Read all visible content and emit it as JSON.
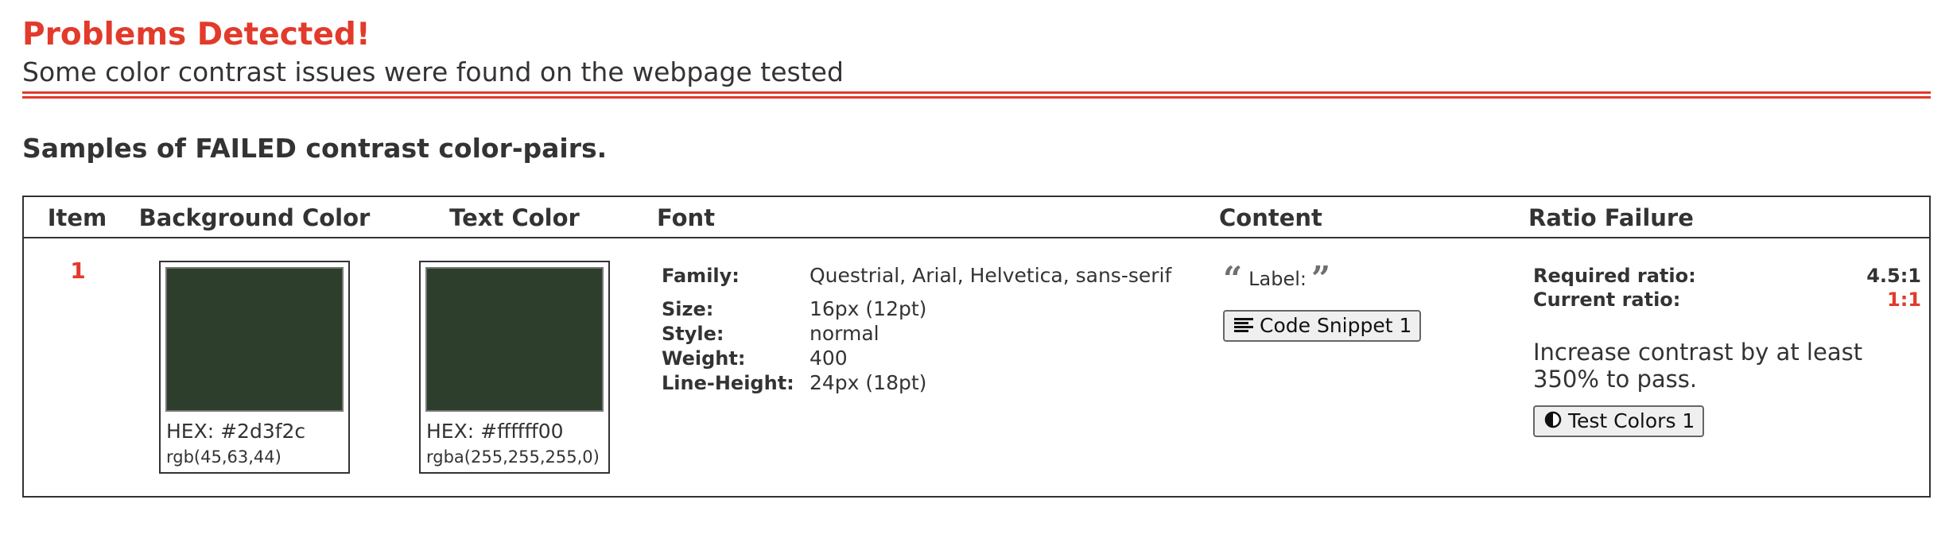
{
  "header": {
    "title": "Problems Detected!",
    "subtitle": "Some color contrast issues were found on the webpage tested"
  },
  "section": {
    "heading": "Samples of FAILED contrast color-pairs."
  },
  "table": {
    "columns": {
      "item": "Item",
      "background": "Background Color",
      "text": "Text Color",
      "font": "Font",
      "content": "Content",
      "ratio": "Ratio Failure"
    },
    "rows": [
      {
        "item": "1",
        "background": {
          "swatch_color": "#2d3f2c",
          "hex": "HEX: #2d3f2c",
          "rgb": "rgb(45,63,44)"
        },
        "text": {
          "swatch_color": "#2d3f2c",
          "hex": "HEX: #ffffff00",
          "rgb": "rgba(255,255,255,0)"
        },
        "font": {
          "family_label": "Family:",
          "family_value": "Questrial, Arial, Helvetica, sans-serif",
          "size_label": "Size:",
          "size_value": "16px (12pt)",
          "style_label": "Style:",
          "style_value": "normal",
          "weight_label": "Weight:",
          "weight_value": "400",
          "line_height_label": "Line-Height:",
          "line_height_value": "24px (18pt)"
        },
        "content": {
          "label": "Label:",
          "open_quote_icon": "quote-left-icon",
          "close_quote_icon": "quote-right-icon",
          "code_button_icon": "align-left-icon",
          "code_button": "Code Snippet 1"
        },
        "ratio": {
          "required_label": "Required ratio:",
          "required_value": "4.5:1",
          "current_label": "Current ratio:",
          "current_value": "1:1",
          "advice": "Increase contrast by at least 350% to pass.",
          "test_button_icon": "adjust-contrast-icon",
          "test_button": "Test Colors 1"
        }
      }
    ]
  },
  "colors": {
    "accent": "#e23a2b",
    "text": "#333333",
    "border": "#333333"
  }
}
